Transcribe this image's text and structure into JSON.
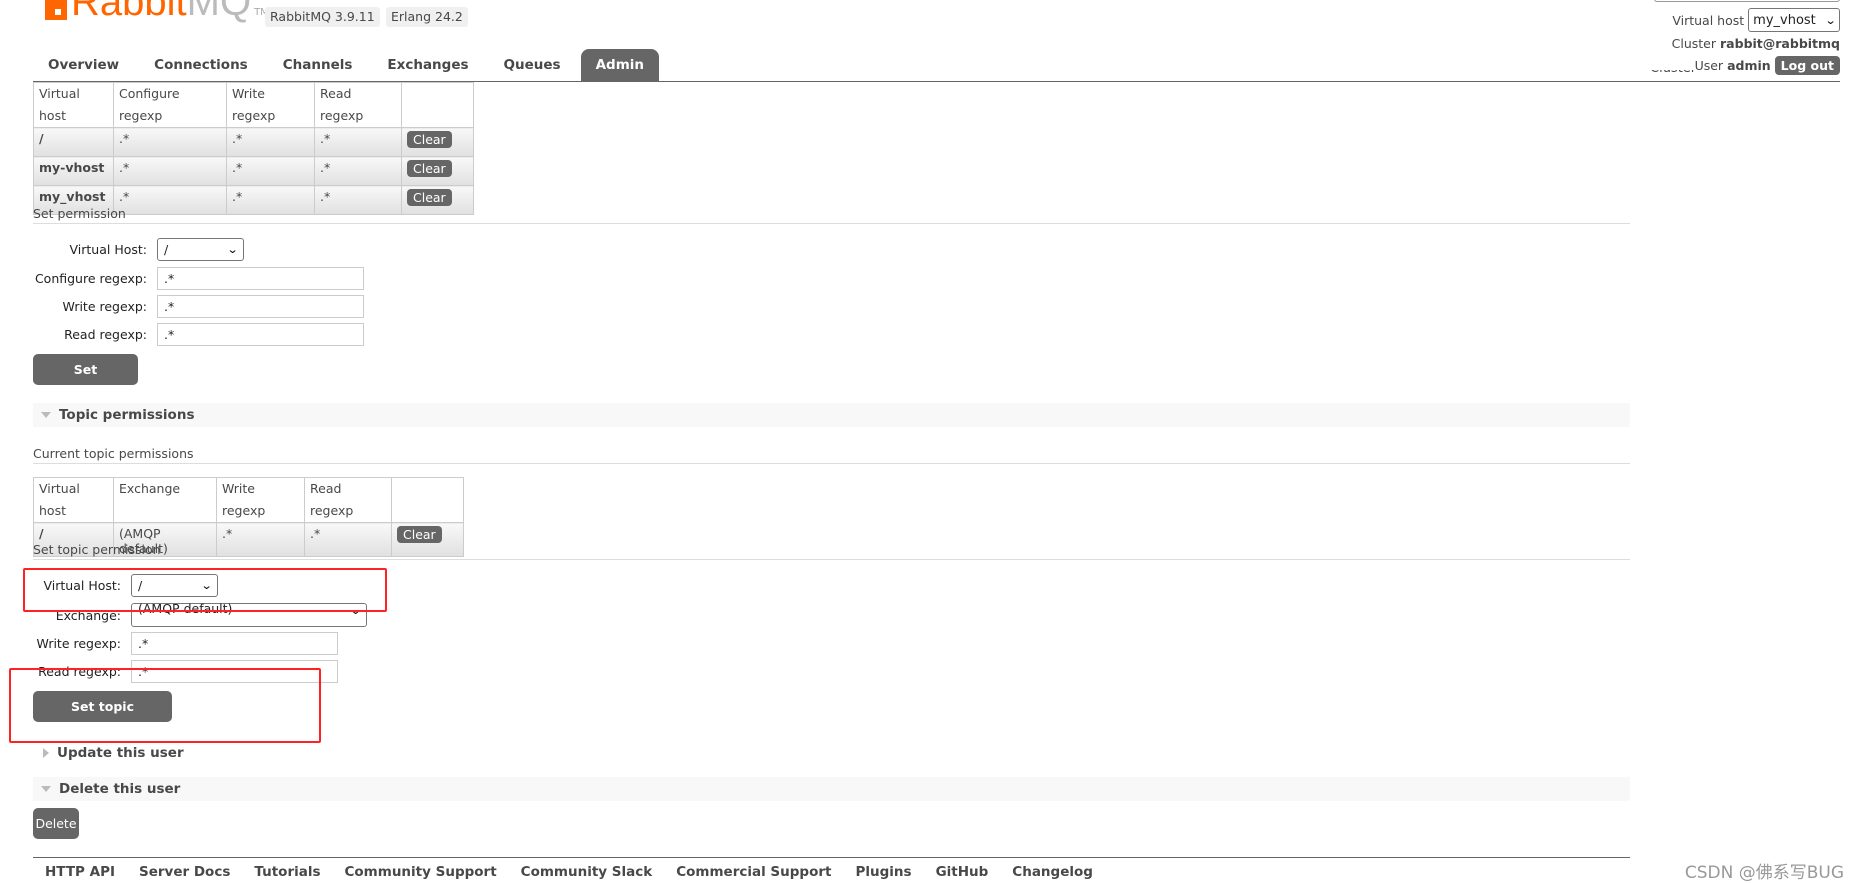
{
  "header": {
    "logo_primary": "Rabbit",
    "logo_secondary": "MQ",
    "logo_tm": "TM",
    "version_badge": "RabbitMQ 3.9.11",
    "erlang_badge": "Erlang 24.2",
    "virtual_host_label": "Virtual host",
    "virtual_host_value": "my_vhost",
    "cluster_label": "Cluster",
    "cluster_value": "rabbit@rabbitmq",
    "user_label": "User",
    "user_value": "admin",
    "logout_label": "Log out",
    "clipped_text": "Cluster"
  },
  "nav": {
    "tabs": [
      "Overview",
      "Connections",
      "Channels",
      "Exchanges",
      "Queues",
      "Admin"
    ],
    "active": "Admin"
  },
  "permissions": {
    "columns": [
      "Virtual host",
      "Configure regexp",
      "Write regexp",
      "Read regexp",
      ""
    ],
    "rows": [
      {
        "vhost": "/",
        "configure": ".*",
        "write": ".*",
        "read": ".*",
        "action": "Clear"
      },
      {
        "vhost": "my-vhost",
        "configure": ".*",
        "write": ".*",
        "read": ".*",
        "action": "Clear"
      },
      {
        "vhost": "my_vhost",
        "configure": ".*",
        "write": ".*",
        "read": ".*",
        "action": "Clear"
      }
    ]
  },
  "set_permission": {
    "heading": "Set permission",
    "vhost_label": "Virtual Host:",
    "vhost_value": "/",
    "configure_label": "Configure regexp:",
    "configure_value": ".*",
    "write_label": "Write regexp:",
    "write_value": ".*",
    "read_label": "Read regexp:",
    "read_value": ".*",
    "submit_label": "Set permission"
  },
  "topic_permissions": {
    "section_title": "Topic permissions",
    "current_heading": "Current topic permissions",
    "columns": [
      "Virtual host",
      "Exchange",
      "Write regexp",
      "Read regexp",
      ""
    ],
    "rows": [
      {
        "vhost": "/",
        "exchange": "(AMQP default)",
        "write": ".*",
        "read": ".*",
        "action": "Clear"
      }
    ]
  },
  "set_topic_permission": {
    "heading": "Set topic permission",
    "vhost_label": "Virtual Host:",
    "vhost_value": "/",
    "exchange_label": "Exchange:",
    "exchange_value": "(AMQP default)",
    "write_label": "Write regexp:",
    "write_value": ".*",
    "read_label": "Read regexp:",
    "read_value": ".*",
    "submit_label": "Set topic permission"
  },
  "update_user": {
    "section_title": "Update this user"
  },
  "delete_user": {
    "section_title": "Delete this user",
    "button_label": "Delete"
  },
  "footer": {
    "links": [
      "HTTP API",
      "Server Docs",
      "Tutorials",
      "Community Support",
      "Community Slack",
      "Commercial Support",
      "Plugins",
      "GitHub",
      "Changelog"
    ]
  },
  "watermark": "CSDN @佛系写BUG",
  "annotation_color": "#ff2222"
}
